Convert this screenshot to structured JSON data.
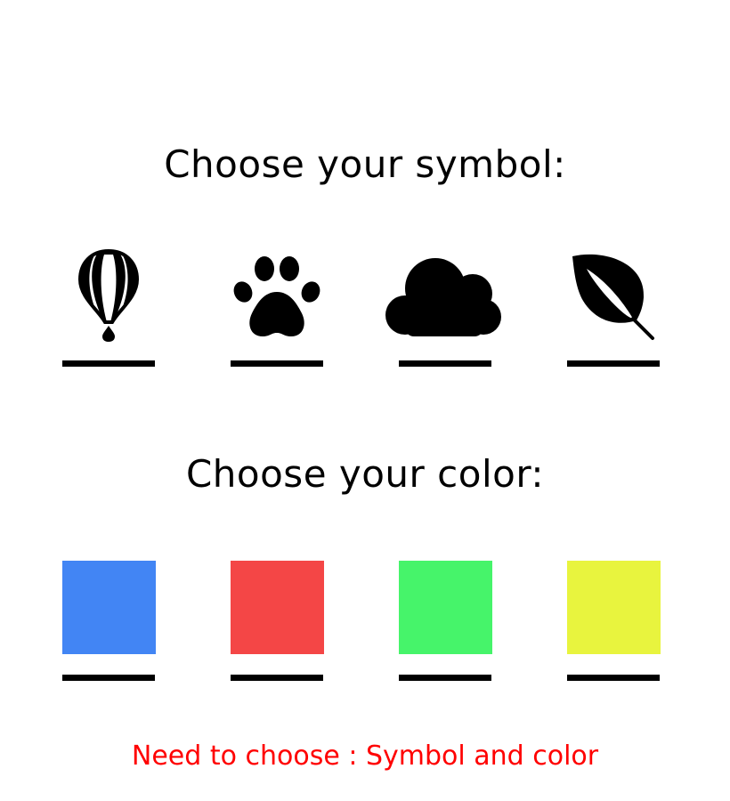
{
  "symbols": {
    "heading": "Choose your symbol:",
    "options": [
      {
        "icon": "hot-air-balloon-icon"
      },
      {
        "icon": "paw-print-icon"
      },
      {
        "icon": "cloud-icon"
      },
      {
        "icon": "leaf-icon"
      }
    ]
  },
  "colors": {
    "heading": "Choose your color:",
    "options": [
      {
        "name": "blue",
        "hex": "#4285f4"
      },
      {
        "name": "red",
        "hex": "#f44646"
      },
      {
        "name": "green",
        "hex": "#46f46a"
      },
      {
        "name": "yellow",
        "hex": "#e8f43e"
      }
    ]
  },
  "status": {
    "message": "Need to choose : Symbol and color",
    "color": "#ff0000"
  }
}
